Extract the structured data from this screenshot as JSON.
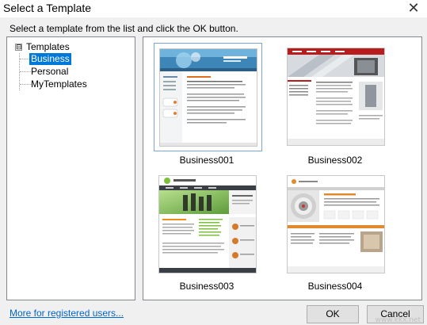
{
  "window": {
    "title": "Select a Template",
    "close_icon": "close-icon"
  },
  "instruction": "Select a template from the list and click the OK button.",
  "tree": {
    "root": {
      "label": "Templates",
      "expander": "⊟"
    },
    "children": [
      {
        "label": "Business",
        "selected": true
      },
      {
        "label": "Personal",
        "selected": false
      },
      {
        "label": "MyTemplates",
        "selected": false
      }
    ]
  },
  "templates": [
    {
      "name": "Business001",
      "selected": true
    },
    {
      "name": "Business002",
      "selected": false
    },
    {
      "name": "Business003",
      "selected": false
    },
    {
      "name": "Business004",
      "selected": false
    }
  ],
  "footer": {
    "link_label": "More for registered users...",
    "ok_label": "OK",
    "cancel_label": "Cancel"
  },
  "watermark": "www.kkx.net",
  "colors": {
    "selection": "#0078d7",
    "link": "#0066cc",
    "selected_border": "#7aa7d9"
  }
}
